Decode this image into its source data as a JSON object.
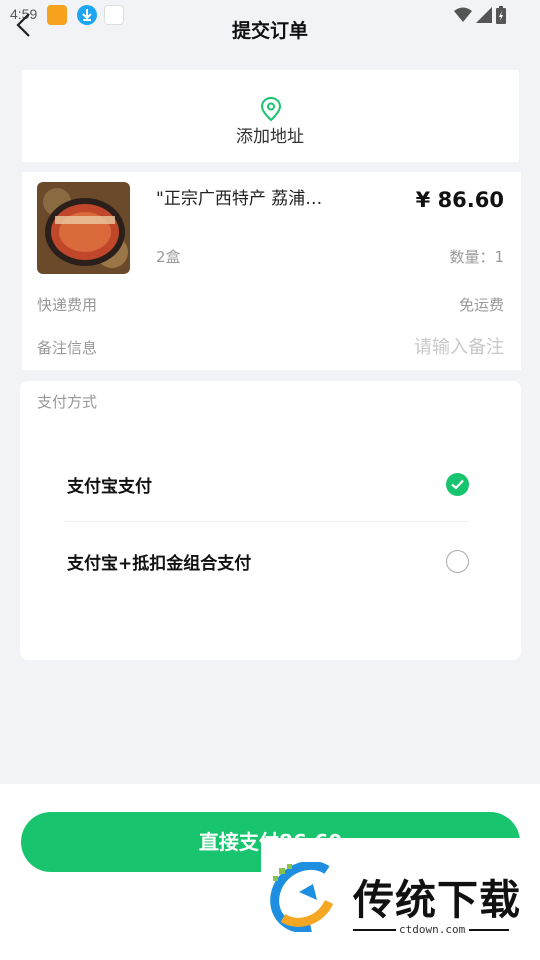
{
  "status_bar": {
    "time": "4:59"
  },
  "header": {
    "title": "提交订单"
  },
  "address": {
    "add_label": "添加地址"
  },
  "product": {
    "title": "\"正宗广西特产 荔浦…",
    "price": "¥ 86.60",
    "spec": "2盒",
    "quantity": "数量：1"
  },
  "shipping": {
    "label": "快递费用",
    "value": "免运费"
  },
  "remark": {
    "label": "备注信息",
    "placeholder": "请输入备注"
  },
  "payment": {
    "title": "支付方式",
    "options": [
      {
        "label": "支付宝支付",
        "selected": true
      },
      {
        "label": "支付宝+抵扣金组合支付",
        "selected": false
      }
    ]
  },
  "footer": {
    "pay_button_label": "直接支付86.60"
  },
  "watermark": {
    "name": "传统下载",
    "domain": "ctdown.com"
  },
  "colors": {
    "accent": "#19c46e",
    "background": "#f2f3f7"
  }
}
